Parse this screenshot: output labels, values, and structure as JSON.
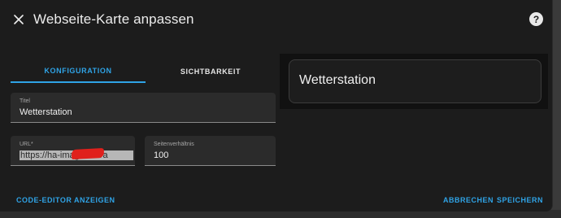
{
  "dialog": {
    "title": "Webseite-Karte anpassen",
    "help_glyph": "?"
  },
  "tabs": [
    {
      "label": "KONFIGURATION",
      "active": true
    },
    {
      "label": "SICHTBARKEIT",
      "active": false
    }
  ],
  "form": {
    "title": {
      "label": "Titel",
      "value": "Wetterstation"
    },
    "url": {
      "label": "URL*",
      "value": "https://ha-imag...win/a"
    },
    "aspect_ratio": {
      "label": "Seitenverhältnis",
      "value": "100"
    }
  },
  "preview": {
    "card_title": "Wetterstation"
  },
  "actions": {
    "code_editor": "CODE-EDITOR ANZEIGEN",
    "cancel": "ABBRECHEN",
    "save": "SPEICHERN"
  },
  "colors": {
    "accent": "#2fa3e6",
    "surface": "#1c1c1c",
    "field": "#2b2b2b",
    "redaction": "#e0201c"
  }
}
